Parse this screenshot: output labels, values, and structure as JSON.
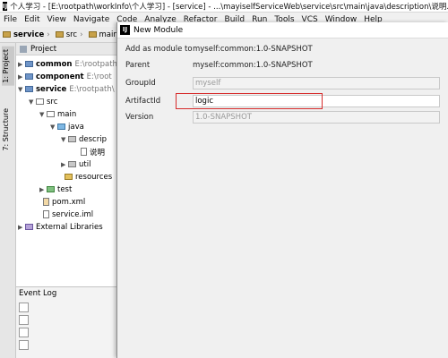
{
  "window": {
    "title": "个人学习 - [E:\\rootpath\\workInfo\\个人学习] - [service] - ...\\mayiselfServiceWeb\\service\\src\\main\\java\\description\\说明.properties"
  },
  "menu": [
    "File",
    "Edit",
    "View",
    "Navigate",
    "Code",
    "Analyze",
    "Refactor",
    "Build",
    "Run",
    "Tools",
    "VCS",
    "Window",
    "Help"
  ],
  "breadcrumb": [
    "service",
    "src",
    "main"
  ],
  "side_tabs": {
    "project": "1: Project",
    "structure": "7: Structure"
  },
  "project_panel": {
    "header": "Project",
    "tree": [
      {
        "label": "common",
        "path": "E:\\rootpath\\",
        "bold": true,
        "icon": "module"
      },
      {
        "label": "component",
        "path": "E:\\root",
        "bold": true,
        "icon": "module"
      },
      {
        "label": "service",
        "path": "E:\\rootpath\\",
        "bold": true,
        "icon": "module"
      },
      {
        "label": "src",
        "icon": "folder"
      },
      {
        "label": "main",
        "icon": "folder"
      },
      {
        "label": "java",
        "icon": "source"
      },
      {
        "label": "descrip",
        "icon": "package"
      },
      {
        "label": "说明",
        "icon": "file"
      },
      {
        "label": "util",
        "icon": "package"
      },
      {
        "label": "resources",
        "icon": "resources"
      },
      {
        "label": "test",
        "icon": "test"
      },
      {
        "label": "pom.xml",
        "icon": "xml"
      },
      {
        "label": "service.iml",
        "icon": "file"
      },
      {
        "label": "External Libraries",
        "icon": "library"
      }
    ]
  },
  "event_log": {
    "header": "Event Log"
  },
  "dialog": {
    "title": "New Module",
    "fields": {
      "add_as_module_label": "Add as module to",
      "add_as_module_value": "myself:common:1.0-SNAPSHOT",
      "parent_label": "Parent",
      "parent_value": "myself:common:1.0-SNAPSHOT",
      "groupid_label": "GroupId",
      "groupid_value": "myself",
      "artifactid_label": "ArtifactId",
      "artifactid_value": "logic",
      "version_label": "Version",
      "version_value": "1.0-SNAPSHOT"
    }
  },
  "colors": {
    "highlight": "#d62b2b"
  }
}
